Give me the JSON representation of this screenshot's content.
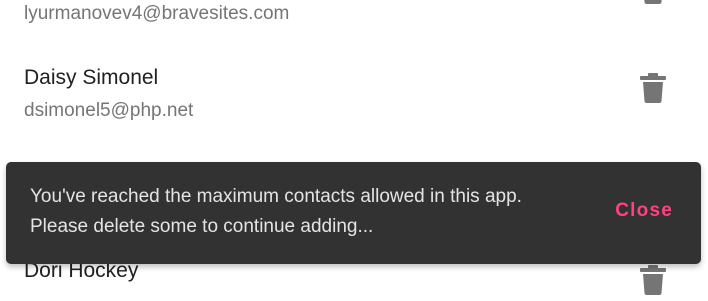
{
  "contacts": [
    {
      "name": "",
      "email": "lyurmanovev4@bravesites.com"
    },
    {
      "name": "Daisy Simonel",
      "email": "dsimonel5@php.net"
    },
    {
      "name": "Dori Hockey",
      "email": ""
    }
  ],
  "icons": {
    "delete": "trash-can-icon"
  },
  "colors": {
    "icon_gray": "#757575",
    "snackbar_bg": "#323232",
    "snackbar_text": "#ffffff",
    "action_accent": "#ff4081"
  },
  "snackbar": {
    "message": "You've reached the maximum contacts allowed in this app. Please delete some to continue adding...",
    "action_label": "Close"
  }
}
